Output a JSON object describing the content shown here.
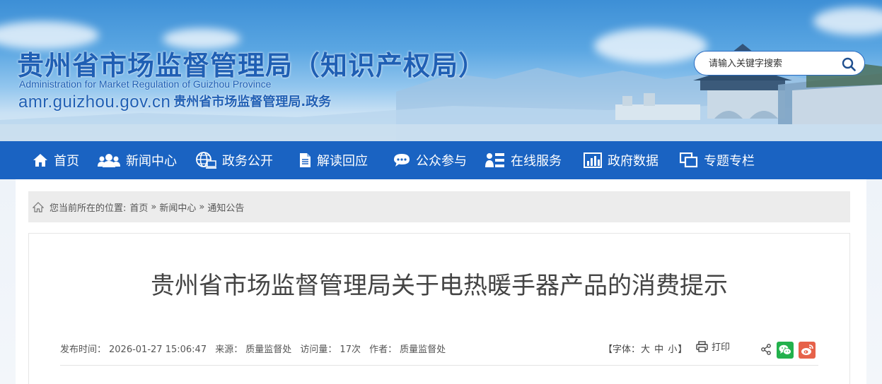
{
  "header": {
    "title": "贵州省市场监督管理局（知识产权局）",
    "subtitle_en": "Administration for Market Regulation of Guizhou Province",
    "domain": "amr.guizhou.gov.cn",
    "domain_suffix": "贵州省市场监督管理局.政务"
  },
  "search": {
    "placeholder": "请输入关键字搜索"
  },
  "nav": {
    "items": [
      {
        "label": "首页",
        "icon": "home-icon"
      },
      {
        "label": "新闻中心",
        "icon": "users-icon"
      },
      {
        "label": "政务公开",
        "icon": "globe-icon"
      },
      {
        "label": "解读回应",
        "icon": "document-icon"
      },
      {
        "label": "公众参与",
        "icon": "chat-icon"
      },
      {
        "label": "在线服务",
        "icon": "person-list-icon"
      },
      {
        "label": "政府数据",
        "icon": "bar-chart-icon"
      },
      {
        "label": "专题专栏",
        "icon": "windows-icon"
      }
    ]
  },
  "breadcrumb": {
    "prefix": "您当前所在的位置:",
    "items": [
      "首页",
      "新闻中心",
      "通知公告"
    ],
    "separator": "»"
  },
  "article": {
    "title": "贵州省市场监督管理局关于电热暖手器产品的消费提示",
    "publish_time_label": "发布时间：",
    "publish_time": "2026-01-27 15:06:47",
    "source_label": "来源：",
    "source": "质量监督处",
    "views_label": "访问量：",
    "views": "17次",
    "author_label": "作者：",
    "author": "质量监督处"
  },
  "tools": {
    "font_open": "【字体：",
    "font_large": "大",
    "font_medium": "中",
    "font_small": "小",
    "font_close": "】",
    "print": "打印"
  },
  "colors": {
    "brand_blue": "#1a63c2",
    "title_blue": "#1f5fb4",
    "wechat_green": "#22b14c",
    "weibo_red": "#e6624a"
  }
}
